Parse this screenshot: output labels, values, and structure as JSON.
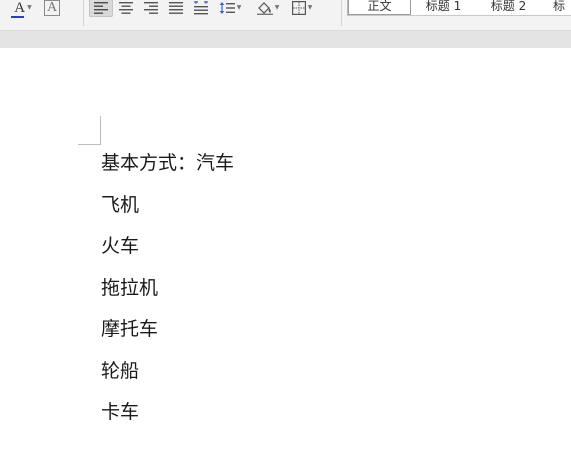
{
  "toolbar": {
    "font_color_letter": "A",
    "highlight_letter": "A",
    "buttons": [
      {
        "name": "align-left-icon"
      },
      {
        "name": "align-center-icon"
      },
      {
        "name": "align-right-icon"
      },
      {
        "name": "justify-icon"
      },
      {
        "name": "distributed-align-icon"
      },
      {
        "name": "line-spacing-icon"
      },
      {
        "name": "shading-icon"
      },
      {
        "name": "borders-icon"
      }
    ],
    "font_color_hex": "#1f3fd1"
  },
  "styles_gallery": {
    "items": [
      "正文",
      "标题 1",
      "标题 2",
      "标"
    ],
    "selected": "正文"
  },
  "document": {
    "paragraphs": [
      "基本方式：汽车",
      "飞机",
      "火车",
      "拖拉机",
      "摩托车",
      "轮船",
      "卡车"
    ]
  }
}
